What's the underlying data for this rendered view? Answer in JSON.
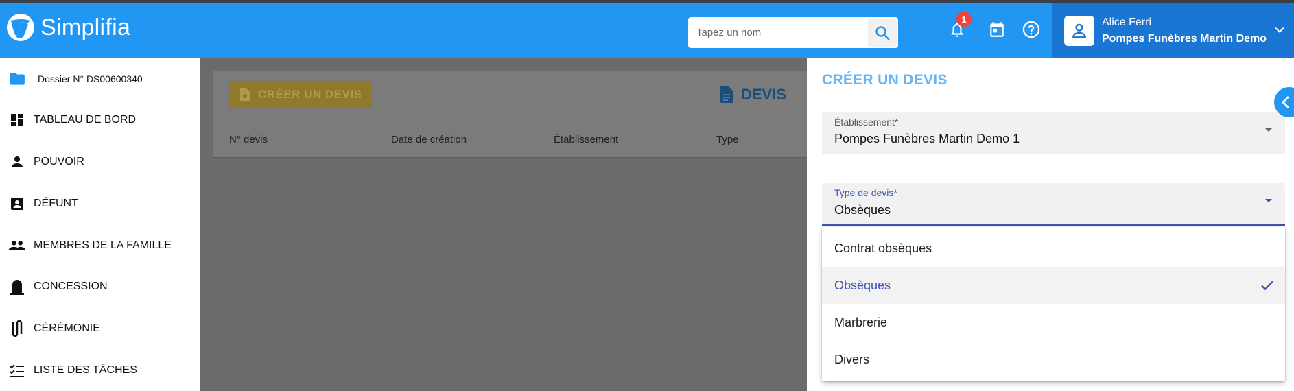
{
  "app": {
    "name": "Simplifia"
  },
  "header": {
    "search": {
      "placeholder": "Tapez un nom",
      "value": ""
    },
    "notifications": {
      "count": "1"
    },
    "user": {
      "name": "Alice Ferri",
      "organization": "Pompes Funèbres Martin Demo"
    }
  },
  "sidebar": {
    "items": [
      {
        "label": "Dossier N° DS00600340",
        "icon": "folder-icon"
      },
      {
        "label": "TABLEAU DE BORD",
        "icon": "dashboard-icon"
      },
      {
        "label": "POUVOIR",
        "icon": "person-icon"
      },
      {
        "label": "DÉFUNT",
        "icon": "contact-card-icon"
      },
      {
        "label": "MEMBRES DE LA FAMILLE",
        "icon": "people-icon"
      },
      {
        "label": "CONCESSION",
        "icon": "tombstone-icon"
      },
      {
        "label": "CÉRÉMONIE",
        "icon": "ceremony-icon"
      },
      {
        "label": "LISTE DES TÂCHES",
        "icon": "checklist-icon"
      }
    ]
  },
  "main": {
    "create_button": "CRÉER UN DEVIS",
    "title": "DEVIS",
    "columns": [
      "N° devis",
      "Date de création",
      "Établissement",
      "Type"
    ]
  },
  "panel": {
    "title": "CRÉER UN DEVIS",
    "establishment": {
      "label": "Établissement*",
      "value": "Pompes Funèbres Martin Demo 1"
    },
    "quote_type": {
      "label": "Type de devis*",
      "value": "Obsèques"
    },
    "options": [
      {
        "label": "Contrat obsèques",
        "selected": false
      },
      {
        "label": "Obsèques",
        "selected": true
      },
      {
        "label": "Marbrerie",
        "selected": false
      },
      {
        "label": "Divers",
        "selected": false
      }
    ]
  },
  "colors": {
    "header": "#2196f3",
    "user_panel": "#1976d2",
    "accent_indigo": "#3f51b5",
    "panel_title": "#64b5f6",
    "badge": "#f44336",
    "overlay": "#6b6b6b"
  }
}
